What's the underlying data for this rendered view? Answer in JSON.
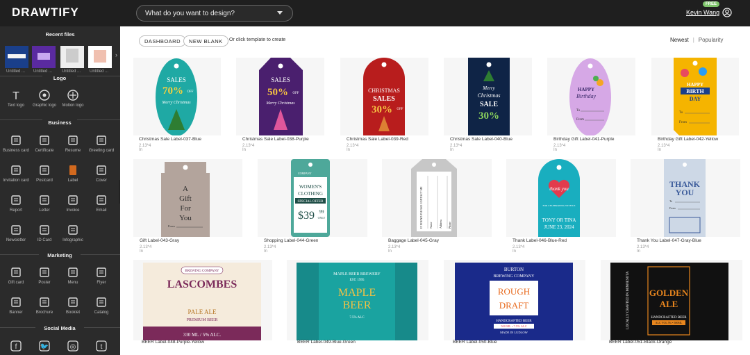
{
  "app": {
    "logo": "DRAWTIFY",
    "search_placeholder": "What do you want to design?",
    "user_name": "Kevin Wang",
    "free_badge": "FREE"
  },
  "sidebar": {
    "recent_title": "Recent files",
    "recent": [
      {
        "label": "Untitled ..."
      },
      {
        "label": "Untitled ..."
      },
      {
        "label": "Untitled ..."
      },
      {
        "label": "Untitled ..."
      }
    ],
    "sections": [
      {
        "title": "Logo",
        "items": [
          "Text logo",
          "Graphic logo",
          "Motion logo"
        ]
      },
      {
        "title": "Business",
        "items": [
          "Business card",
          "Certificate",
          "Resume",
          "Greeting card",
          "Invitation card",
          "Postcard",
          "Label",
          "Cover",
          "Report",
          "Letter",
          "Invoice",
          "Email",
          "Newsletter",
          "ID Card",
          "Infographic"
        ]
      },
      {
        "title": "Marketing",
        "items": [
          "Gift card",
          "Poster",
          "Menu",
          "Flyer",
          "Banner",
          "Brochure",
          "Booklet",
          "Catalog"
        ]
      },
      {
        "title": "Social Media",
        "items": []
      }
    ]
  },
  "toolbar": {
    "dashboard": "DASHBOARD",
    "new_blank": "NEW BLANK",
    "hint": "Or click template to create",
    "sort_newest": "Newest",
    "sort_popularity": "Popularity"
  },
  "row1": [
    {
      "name": "Christmas Sale Label-037-Blue",
      "size": "2.13*4 In",
      "l1": "SALES",
      "l2": "70%",
      "l3": "OFF",
      "l4": "Merry Christmas"
    },
    {
      "name": "Christmas Sale Label-038-Purple",
      "size": "2.13*4 In",
      "l1": "SALES",
      "l2": "50%",
      "l3": "OFF",
      "l4": "Merry Christmas"
    },
    {
      "name": "Christmas Sale Label-039-Red",
      "size": "2.13*4 In",
      "l1": "CHRISTMAS",
      "l2": "SALES",
      "l3": "30%",
      "l4": "OFF"
    },
    {
      "name": "Christmas Sale Label-040-Blue",
      "size": "2.13*4 In",
      "l1": "Merry",
      "l2": "Christmas",
      "l3": "SALE",
      "l4": "30%"
    },
    {
      "name": "Birthday Gift Label-041-Purple",
      "size": "2.13*4 In",
      "l1": "HAPPY",
      "l2": "Birthday",
      "l3": "To",
      "l4": "From"
    },
    {
      "name": "Birthday Gift Label-042-Yellow",
      "size": "2.13*4 In",
      "l1": "HAPPY",
      "l2": "BIRTH",
      "l3": "DAY",
      "l4": "To",
      "l5": "From"
    }
  ],
  "row2": [
    {
      "name": "Gift Label-043-Gray",
      "size": "2.13*4 In",
      "l1": "A",
      "l2": "Gift",
      "l3": "For",
      "l4": "You",
      "l5": "From"
    },
    {
      "name": "Shopping Label-044-Green",
      "size": "2.13*4 In",
      "l1": "COMPANY",
      "l2": "WOMEN'S",
      "l3": "CLOTHING",
      "l4": "SPECIAL OFFER",
      "l5": "$39",
      "l6": "99",
      "l7": "ONLY"
    },
    {
      "name": "Baggage Label-045-Gray",
      "size": "2.13*4 In",
      "l1": "IF FOUND PLEASE CONTACT ME",
      "l2": "Name",
      "l3": "Address",
      "l4": "Phone"
    },
    {
      "name": "Thank Label-046-Blue-Red",
      "size": "2.13*4 In",
      "l1": "thank you",
      "l2": "FOR CELEBRATING WITH US",
      "l3": "TONY OR TINA",
      "l4": "JUNE 23, 2024"
    },
    {
      "name": "Thank You Label-047-Gray-Blue",
      "size": "2.13*4 In",
      "l1": "THANK",
      "l2": "YOU",
      "l3": "To",
      "l4": "From"
    }
  ],
  "row3": [
    {
      "name": "BEER Label-048-Purple-Yellow",
      "l1": "BREWING COMPANY",
      "l2": "LASCOMBES",
      "l3": "PALE ALE",
      "l4": "PREMIUM BEER",
      "l5": "330 ML / 5% ALC."
    },
    {
      "name": "BEER Label-049-Blue-Green",
      "l1": "MAPLE BEER BREWERY",
      "l2": "EST. 1995",
      "l3": "MAPLE",
      "l4": "BEER",
      "l5": "7.5% ALC"
    },
    {
      "name": "BEER Label-050-Blue",
      "l1": "BURTON",
      "l2": "BREWING COMPANY",
      "l3": "ROUGH",
      "l4": "DRAFT",
      "l5": "HANDCRAFTED BEER",
      "l6": "500 ML • 7.5% ALC",
      "l7": "MADE IN LUDLOW"
    },
    {
      "name": "BEER Label-051-Black-Orange",
      "l1": "GOLDEN",
      "l2": "ALE",
      "l3": "HANDCRAFTED BEER",
      "l4": "ALC VOL 5% • 500ML",
      "l5": "LOCALLY CRAFTED IN MINNESOTA"
    }
  ]
}
